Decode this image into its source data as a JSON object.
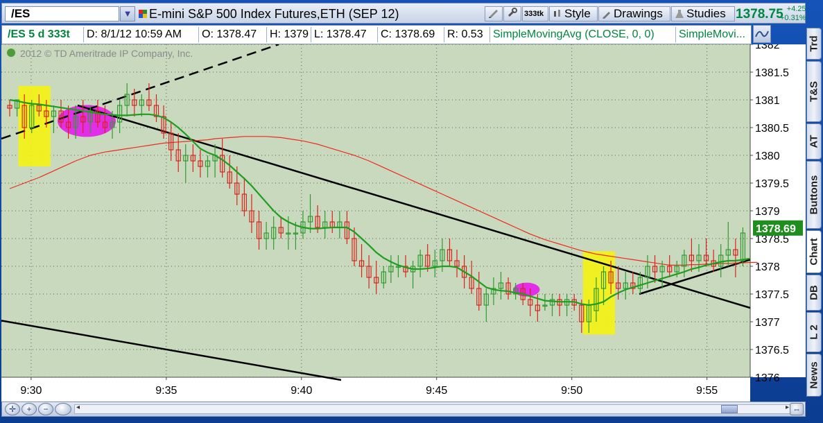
{
  "header": {
    "symbol": "/ES",
    "description": "E-mini S&P 500 Index Futures,ETH (SEP 12)",
    "buttons": {
      "tick_badge": "333tk",
      "style": "Style",
      "drawings": "Drawings",
      "studies": "Studies"
    },
    "last_price": "1378.75",
    "net_change": "+4.25",
    "percent_change": "+0.31%"
  },
  "infobar": {
    "symbol_period": "/ES 5 d 333t",
    "date": "D: 8/1/12 10:59 AM",
    "open": "O: 1378.47",
    "high": "H: 1379",
    "low": "L: 1378.47",
    "close": "C: 1378.69",
    "range": "R: 0.53",
    "study1": "SimpleMovingAvg (CLOSE, 0, 0)",
    "study2": "SimpleMovi..."
  },
  "side_tabs": [
    "Trd",
    "T&S",
    "AT",
    "Buttons",
    "Chart",
    "DB",
    "L 2",
    "News"
  ],
  "chart_data": {
    "type": "candlestick",
    "copyright": "2012 © TD Ameritrade IP Company, Inc.",
    "ylim": [
      1376,
      1382
    ],
    "y_ticks": [
      1382,
      1381.5,
      1381,
      1380.5,
      1380,
      1379.5,
      1379,
      1378.5,
      1378,
      1377.5,
      1377,
      1376.5,
      1376
    ],
    "x_ticks": [
      "9:30",
      "9:35",
      "9:40",
      "9:45",
      "9:50",
      "9:55"
    ],
    "x_tick_minutes": [
      30,
      35,
      40,
      45,
      50,
      55
    ],
    "xlim_minutes": [
      28.9,
      56.6
    ],
    "price_label": "1378.69",
    "candles": [
      {
        "o": 1380.9,
        "h": 1381.0,
        "l": 1380.7,
        "c": 1380.85
      },
      {
        "o": 1380.85,
        "h": 1381.0,
        "l": 1380.7,
        "c": 1381.0
      },
      {
        "o": 1380.9,
        "h": 1381.1,
        "l": 1380.3,
        "c": 1380.5
      },
      {
        "o": 1380.5,
        "h": 1381.0,
        "l": 1380.4,
        "c": 1380.9
      },
      {
        "o": 1380.9,
        "h": 1381.1,
        "l": 1380.7,
        "c": 1380.8
      },
      {
        "o": 1380.8,
        "h": 1381.0,
        "l": 1380.5,
        "c": 1380.7
      },
      {
        "o": 1380.7,
        "h": 1380.9,
        "l": 1380.4,
        "c": 1380.8
      },
      {
        "o": 1380.8,
        "h": 1381.0,
        "l": 1380.5,
        "c": 1380.6
      },
      {
        "o": 1380.6,
        "h": 1380.9,
        "l": 1380.3,
        "c": 1380.5
      },
      {
        "o": 1380.5,
        "h": 1380.9,
        "l": 1380.3,
        "c": 1380.7
      },
      {
        "o": 1380.7,
        "h": 1381.0,
        "l": 1380.4,
        "c": 1380.6
      },
      {
        "o": 1380.6,
        "h": 1380.9,
        "l": 1380.4,
        "c": 1380.8
      },
      {
        "o": 1380.8,
        "h": 1381.0,
        "l": 1380.5,
        "c": 1380.6
      },
      {
        "o": 1380.6,
        "h": 1380.9,
        "l": 1380.4,
        "c": 1380.5
      },
      {
        "o": 1380.5,
        "h": 1380.8,
        "l": 1380.3,
        "c": 1380.6
      },
      {
        "o": 1380.6,
        "h": 1381.0,
        "l": 1380.4,
        "c": 1380.9
      },
      {
        "o": 1380.9,
        "h": 1381.3,
        "l": 1380.7,
        "c": 1381.1
      },
      {
        "o": 1381.0,
        "h": 1381.2,
        "l": 1380.7,
        "c": 1380.9
      },
      {
        "o": 1380.9,
        "h": 1381.1,
        "l": 1380.7,
        "c": 1381.0
      },
      {
        "o": 1381.0,
        "h": 1381.3,
        "l": 1380.8,
        "c": 1380.9
      },
      {
        "o": 1380.9,
        "h": 1381.1,
        "l": 1380.6,
        "c": 1380.7
      },
      {
        "o": 1380.7,
        "h": 1380.9,
        "l": 1380.3,
        "c": 1380.4
      },
      {
        "o": 1380.4,
        "h": 1380.6,
        "l": 1379.9,
        "c": 1380.1
      },
      {
        "o": 1380.1,
        "h": 1380.4,
        "l": 1379.7,
        "c": 1379.9
      },
      {
        "o": 1379.9,
        "h": 1380.2,
        "l": 1379.5,
        "c": 1380.0
      },
      {
        "o": 1380.0,
        "h": 1380.2,
        "l": 1379.7,
        "c": 1379.9
      },
      {
        "o": 1379.9,
        "h": 1380.1,
        "l": 1379.6,
        "c": 1379.8
      },
      {
        "o": 1379.8,
        "h": 1380.0,
        "l": 1379.6,
        "c": 1379.9
      },
      {
        "o": 1379.9,
        "h": 1380.2,
        "l": 1379.6,
        "c": 1380.0
      },
      {
        "o": 1380.0,
        "h": 1380.3,
        "l": 1379.6,
        "c": 1379.7
      },
      {
        "o": 1379.7,
        "h": 1380.0,
        "l": 1379.4,
        "c": 1379.5
      },
      {
        "o": 1379.5,
        "h": 1379.8,
        "l": 1379.1,
        "c": 1379.3
      },
      {
        "o": 1379.3,
        "h": 1379.6,
        "l": 1378.9,
        "c": 1379.0
      },
      {
        "o": 1379.0,
        "h": 1379.3,
        "l": 1378.6,
        "c": 1378.8
      },
      {
        "o": 1378.8,
        "h": 1379.0,
        "l": 1378.3,
        "c": 1378.5
      },
      {
        "o": 1378.5,
        "h": 1378.8,
        "l": 1378.3,
        "c": 1378.6
      },
      {
        "o": 1378.5,
        "h": 1378.9,
        "l": 1378.3,
        "c": 1378.7
      },
      {
        "o": 1378.7,
        "h": 1378.9,
        "l": 1378.5,
        "c": 1378.6
      },
      {
        "o": 1378.6,
        "h": 1378.9,
        "l": 1378.3,
        "c": 1378.6
      },
      {
        "o": 1378.6,
        "h": 1378.8,
        "l": 1378.3,
        "c": 1378.6
      },
      {
        "o": 1378.6,
        "h": 1379.0,
        "l": 1378.5,
        "c": 1378.8
      },
      {
        "o": 1378.8,
        "h": 1379.3,
        "l": 1378.6,
        "c": 1378.9
      },
      {
        "o": 1378.9,
        "h": 1379.1,
        "l": 1378.6,
        "c": 1378.7
      },
      {
        "o": 1378.7,
        "h": 1379.0,
        "l": 1378.5,
        "c": 1378.8
      },
      {
        "o": 1378.8,
        "h": 1379.0,
        "l": 1378.6,
        "c": 1378.7
      },
      {
        "o": 1378.7,
        "h": 1379.0,
        "l": 1378.5,
        "c": 1378.8
      },
      {
        "o": 1378.8,
        "h": 1379.0,
        "l": 1378.4,
        "c": 1378.5
      },
      {
        "o": 1378.5,
        "h": 1378.7,
        "l": 1378.0,
        "c": 1378.1
      },
      {
        "o": 1378.1,
        "h": 1378.4,
        "l": 1377.8,
        "c": 1378.0
      },
      {
        "o": 1378.0,
        "h": 1378.2,
        "l": 1377.6,
        "c": 1377.8
      },
      {
        "o": 1377.8,
        "h": 1378.1,
        "l": 1377.5,
        "c": 1377.7
      },
      {
        "o": 1377.7,
        "h": 1378.0,
        "l": 1377.6,
        "c": 1377.9
      },
      {
        "o": 1377.9,
        "h": 1378.2,
        "l": 1377.7,
        "c": 1378.0
      },
      {
        "o": 1378.0,
        "h": 1378.2,
        "l": 1377.8,
        "c": 1378.0
      },
      {
        "o": 1378.0,
        "h": 1378.2,
        "l": 1377.8,
        "c": 1377.9
      },
      {
        "o": 1377.9,
        "h": 1378.1,
        "l": 1377.6,
        "c": 1378.0
      },
      {
        "o": 1378.0,
        "h": 1378.3,
        "l": 1377.8,
        "c": 1378.2
      },
      {
        "o": 1378.2,
        "h": 1378.4,
        "l": 1377.9,
        "c": 1378.0
      },
      {
        "o": 1378.0,
        "h": 1378.3,
        "l": 1377.8,
        "c": 1378.1
      },
      {
        "o": 1378.1,
        "h": 1378.5,
        "l": 1377.9,
        "c": 1378.3
      },
      {
        "o": 1378.3,
        "h": 1378.5,
        "l": 1378.0,
        "c": 1378.1
      },
      {
        "o": 1378.1,
        "h": 1378.3,
        "l": 1377.8,
        "c": 1378.0
      },
      {
        "o": 1378.0,
        "h": 1378.2,
        "l": 1377.6,
        "c": 1377.8
      },
      {
        "o": 1377.8,
        "h": 1378.1,
        "l": 1377.5,
        "c": 1377.6
      },
      {
        "o": 1377.6,
        "h": 1377.9,
        "l": 1377.2,
        "c": 1377.3
      },
      {
        "o": 1377.3,
        "h": 1377.6,
        "l": 1377.0,
        "c": 1377.5
      },
      {
        "o": 1377.5,
        "h": 1377.8,
        "l": 1377.3,
        "c": 1377.6
      },
      {
        "o": 1377.6,
        "h": 1377.9,
        "l": 1377.4,
        "c": 1377.7
      },
      {
        "o": 1377.7,
        "h": 1377.8,
        "l": 1377.4,
        "c": 1377.5
      },
      {
        "o": 1377.5,
        "h": 1377.7,
        "l": 1377.4,
        "c": 1377.6
      },
      {
        "o": 1377.6,
        "h": 1377.7,
        "l": 1377.3,
        "c": 1377.4
      },
      {
        "o": 1377.4,
        "h": 1377.6,
        "l": 1377.1,
        "c": 1377.3
      },
      {
        "o": 1377.3,
        "h": 1377.5,
        "l": 1377.0,
        "c": 1377.2
      },
      {
        "o": 1377.3,
        "h": 1377.5,
        "l": 1377.2,
        "c": 1377.3
      },
      {
        "o": 1377.3,
        "h": 1377.5,
        "l": 1377.1,
        "c": 1377.4
      },
      {
        "o": 1377.4,
        "h": 1377.5,
        "l": 1377.1,
        "c": 1377.3
      },
      {
        "o": 1377.3,
        "h": 1377.5,
        "l": 1377.1,
        "c": 1377.4
      },
      {
        "o": 1377.4,
        "h": 1377.5,
        "l": 1377.2,
        "c": 1377.3
      },
      {
        "o": 1377.3,
        "h": 1377.4,
        "l": 1376.8,
        "c": 1377.0
      },
      {
        "o": 1377.0,
        "h": 1377.4,
        "l": 1376.8,
        "c": 1377.3
      },
      {
        "o": 1377.2,
        "h": 1377.8,
        "l": 1377.0,
        "c": 1377.6
      },
      {
        "o": 1377.6,
        "h": 1378.0,
        "l": 1377.3,
        "c": 1377.9
      },
      {
        "o": 1377.9,
        "h": 1378.1,
        "l": 1377.5,
        "c": 1377.7
      },
      {
        "o": 1377.7,
        "h": 1378.0,
        "l": 1377.4,
        "c": 1377.6
      },
      {
        "o": 1377.6,
        "h": 1377.9,
        "l": 1377.4,
        "c": 1377.7
      },
      {
        "o": 1377.7,
        "h": 1377.9,
        "l": 1377.5,
        "c": 1377.6
      },
      {
        "o": 1377.6,
        "h": 1377.9,
        "l": 1377.5,
        "c": 1377.8
      },
      {
        "o": 1377.8,
        "h": 1378.2,
        "l": 1377.6,
        "c": 1378.0
      },
      {
        "o": 1378.0,
        "h": 1378.2,
        "l": 1377.7,
        "c": 1377.9
      },
      {
        "o": 1377.9,
        "h": 1378.1,
        "l": 1377.6,
        "c": 1378.0
      },
      {
        "o": 1378.0,
        "h": 1378.2,
        "l": 1377.8,
        "c": 1377.9
      },
      {
        "o": 1377.9,
        "h": 1378.1,
        "l": 1377.8,
        "c": 1378.0
      },
      {
        "o": 1378.0,
        "h": 1378.3,
        "l": 1377.8,
        "c": 1378.2
      },
      {
        "o": 1378.2,
        "h": 1378.5,
        "l": 1377.9,
        "c": 1378.1
      },
      {
        "o": 1378.1,
        "h": 1378.4,
        "l": 1377.9,
        "c": 1378.2
      },
      {
        "o": 1378.2,
        "h": 1378.5,
        "l": 1378.0,
        "c": 1378.1
      },
      {
        "o": 1378.1,
        "h": 1378.3,
        "l": 1377.9,
        "c": 1378.0
      },
      {
        "o": 1378.0,
        "h": 1378.4,
        "l": 1377.8,
        "c": 1378.2
      },
      {
        "o": 1378.2,
        "h": 1378.8,
        "l": 1378.0,
        "c": 1378.3
      },
      {
        "o": 1378.3,
        "h": 1378.5,
        "l": 1377.8,
        "c": 1378.2
      },
      {
        "o": 1378.1,
        "h": 1378.7,
        "l": 1378.0,
        "c": 1378.6
      }
    ],
    "green_sma": [
      1381.0,
      1380.98,
      1380.95,
      1380.93,
      1380.92,
      1380.9,
      1380.88,
      1380.86,
      1380.84,
      1380.82,
      1380.8,
      1380.78,
      1380.76,
      1380.74,
      1380.73,
      1380.72,
      1380.72,
      1380.73,
      1380.74,
      1380.74,
      1380.72,
      1380.68,
      1380.6,
      1380.5,
      1380.38,
      1380.25,
      1380.12,
      1380.05,
      1380.0,
      1379.92,
      1379.82,
      1379.7,
      1379.58,
      1379.45,
      1379.3,
      1379.15,
      1379.0,
      1378.88,
      1378.8,
      1378.74,
      1378.7,
      1378.68,
      1378.68,
      1378.69,
      1378.7,
      1378.7,
      1378.7,
      1378.62,
      1378.5,
      1378.38,
      1378.25,
      1378.15,
      1378.08,
      1378.02,
      1377.98,
      1377.95,
      1377.95,
      1377.96,
      1377.98,
      1378.0,
      1378.0,
      1377.98,
      1377.9,
      1377.82,
      1377.72,
      1377.62,
      1377.58,
      1377.56,
      1377.55,
      1377.52,
      1377.5,
      1377.46,
      1377.42,
      1377.38,
      1377.37,
      1377.36,
      1377.36,
      1377.36,
      1377.32,
      1377.3,
      1377.32,
      1377.36,
      1377.45,
      1377.52,
      1377.58,
      1377.62,
      1377.66,
      1377.7,
      1377.74,
      1377.78,
      1377.82,
      1377.86,
      1377.9,
      1377.95,
      1377.98,
      1378.02,
      1378.05,
      1378.08,
      1378.1,
      1378.1,
      1378.12,
      1378.14
    ],
    "red_sma": [
      1379.4,
      1379.45,
      1379.5,
      1379.55,
      1379.6,
      1379.66,
      1379.72,
      1379.78,
      1379.84,
      1379.9,
      1379.95,
      1380.0,
      1380.03,
      1380.06,
      1380.08,
      1380.1,
      1380.12,
      1380.14,
      1380.16,
      1380.18,
      1380.2,
      1380.22,
      1380.23,
      1380.24,
      1380.25,
      1380.26,
      1380.27,
      1380.28,
      1380.3,
      1380.31,
      1380.32,
      1380.33,
      1380.34,
      1380.34,
      1380.34,
      1380.34,
      1380.33,
      1380.32,
      1380.3,
      1380.28,
      1380.26,
      1380.23,
      1380.2,
      1380.16,
      1380.12,
      1380.08,
      1380.04,
      1380.0,
      1379.95,
      1379.9,
      1379.84,
      1379.78,
      1379.72,
      1379.66,
      1379.6,
      1379.54,
      1379.48,
      1379.42,
      1379.36,
      1379.3,
      1379.24,
      1379.18,
      1379.12,
      1379.06,
      1379.0,
      1378.94,
      1378.88,
      1378.82,
      1378.76,
      1378.7,
      1378.64,
      1378.58,
      1378.53,
      1378.48,
      1378.44,
      1378.4,
      1378.36,
      1378.32,
      1378.28,
      1378.25,
      1378.22,
      1378.2,
      1378.18,
      1378.16,
      1378.14,
      1378.12,
      1378.1,
      1378.08,
      1378.06,
      1378.04,
      1378.02,
      1378.02,
      1378.02,
      1378.03,
      1378.03,
      1378.04,
      1378.04,
      1378.05,
      1378.05,
      1378.06,
      1378.06,
      1378.07,
      1378.07
    ]
  }
}
